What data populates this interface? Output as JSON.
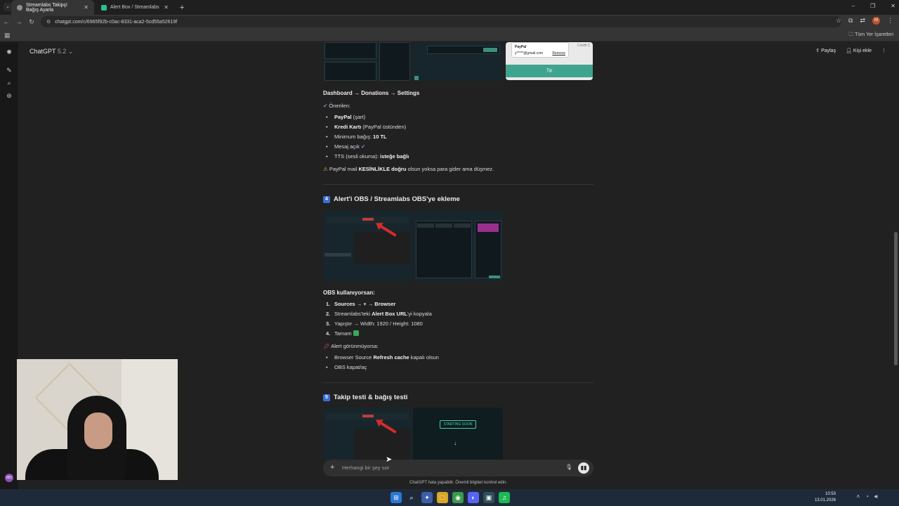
{
  "browser": {
    "tabs": [
      {
        "title": "Streamlabs Takipçi Bağış Ayarla",
        "active": true
      },
      {
        "title": "Alert Box / Streamlabs",
        "active": false
      }
    ],
    "url": "chatgpt.com/c/6965f92b-c0ac-8331-aca2-5cd55a52619f",
    "profile_initial": "M",
    "all_bookmarks": "Tüm Yer İşaretleri"
  },
  "app": {
    "model": "ChatGPT",
    "model_version": "5.2",
    "share": "Paylaş",
    "add_person": "Kişi ekle",
    "composer_placeholder": "Herhangi bir şey sor",
    "disclaimer": "ChatGPT hata yapabilir. Önemli bilgileri kontrol edin.",
    "avatar_initials": "MD"
  },
  "preview_card": {
    "paypal_label": "PayPal",
    "email_masked": "y*****@gmail.com",
    "remove": "Remove",
    "credit": "Credit C",
    "tip_button": "Tip"
  },
  "section_donations": {
    "path": "Dashboard → Donations → Settings",
    "recommended": "Önerilen:",
    "items": [
      {
        "bold": "PayPal",
        "rest": " (şart)"
      },
      {
        "bold": "Kredi Kartı",
        "rest": " (PayPal üstünden)"
      },
      {
        "pre": "Minimum bağış: ",
        "bold": "10 TL"
      },
      {
        "pre": "Mesaj açık ",
        "tick": "✔"
      },
      {
        "pre": "TTS (sesli okuma): ",
        "bold": "isteğe bağlı"
      }
    ],
    "warning_pre": "PayPal mail ",
    "warning_bold": "KESİNLİKLE doğru",
    "warning_post": " olsun yoksa para gider ama düşmez."
  },
  "section_obs": {
    "number": "4",
    "title": "Alert'i OBS / Streamlabs OBS'ye ekleme",
    "subtitle": "OBS kullanıyorsan:",
    "steps": [
      {
        "bold": "Sources → + → Browser"
      },
      {
        "pre": "Streamlabs'teki ",
        "bold": "Alert Box URL",
        "post": "'yi kopyala"
      },
      {
        "pre": "Yapıştır → Width: 1920 / Height: 1080"
      },
      {
        "pre": "Tamam "
      }
    ],
    "not_visible": "Alert görünmüyorsa:",
    "fixes": [
      {
        "pre": "Browser Source ",
        "bold": "Refresh cache",
        "post": " kapalı olsun"
      },
      {
        "pre": "OBS kapat/aç"
      }
    ]
  },
  "section_test": {
    "number": "5",
    "title": "Takip testi & bağış testi",
    "starting_soon": "STARTING SOON"
  },
  "taskbar": {
    "time": "10:53",
    "date": "13.01.2026"
  }
}
